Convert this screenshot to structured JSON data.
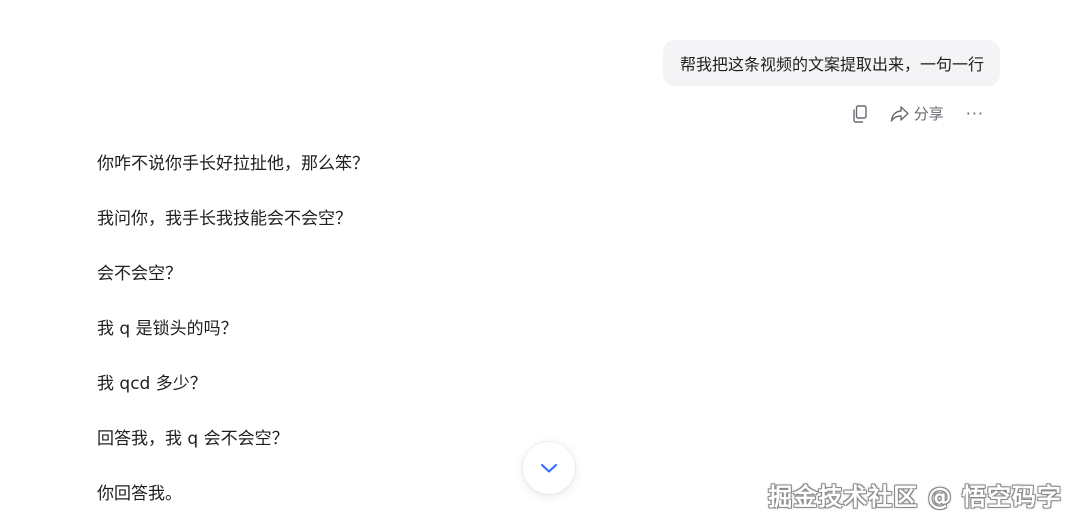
{
  "user_message": {
    "text": "帮我把这条视频的文案提取出来，一句一行"
  },
  "message_actions": {
    "copy_icon": "copy-icon",
    "share_icon": "share-icon",
    "share_label": "分享",
    "more_label": "···"
  },
  "reply": {
    "lines": [
      "你咋不说你手长好拉扯他，那么笨？",
      "我问你，我手长我技能会不会空？",
      "会不会空？",
      "我 q 是锁头的吗？",
      "我 qcd 多少？",
      "回答我，我 q 会不会空？",
      "你回答我。"
    ]
  },
  "scroll_down_button": {
    "icon": "chevron-down-icon",
    "color": "#3370ff"
  },
  "watermark": {
    "text": "掘金技术社区 @ 悟空码字"
  }
}
